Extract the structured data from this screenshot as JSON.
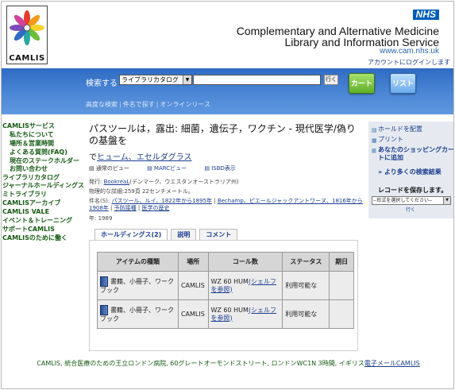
{
  "header": {
    "logo_text": "CAMLIS",
    "nhs_badge": "NHS",
    "site_title_line1": "Complementary and Alternative Medicine",
    "site_title_line2": "Library and Information Service",
    "site_url": "www.cam.nhs.uk",
    "login_link": "アカウントにログインします"
  },
  "search": {
    "label": "検索する",
    "catalog_select": "ライブラリカタログ",
    "query": "",
    "go_label": "行く",
    "cart_label": "カート",
    "list_label": "リスト",
    "links": [
      "高度な検索",
      "件名で探す",
      "オンラインリース"
    ]
  },
  "left_nav": {
    "items": [
      {
        "label": "CAMLISサービス",
        "indent": false
      },
      {
        "label": "私たちについて",
        "indent": true
      },
      {
        "label": "場所＆営業時間",
        "indent": true
      },
      {
        "label": "よくある質問(FAQ)",
        "indent": true
      },
      {
        "label": "現在のステークホルダー",
        "indent": true
      },
      {
        "label": "お問い合わせ",
        "indent": true
      },
      {
        "label": "ライブラリカタログ",
        "indent": false
      },
      {
        "label": "ジャーナルホールディングス",
        "indent": false
      },
      {
        "label": "ミトライブラリ",
        "indent": false
      },
      {
        "label": "CAMLISアーカイブ",
        "indent": false
      },
      {
        "label": "CAMLIS VALE",
        "indent": false
      },
      {
        "label": "イベント＆トレーニング",
        "indent": false
      },
      {
        "label": "サポートCAMLIS",
        "indent": false
      },
      {
        "label": "CAMLISのために働く",
        "indent": false
      }
    ]
  },
  "record": {
    "title": "パスツールは，露出: 細菌，遺伝子，ワクチン - 現代医学/偽りの基盤を",
    "author_prefix": "で",
    "author": "ヒューム、エセルダグラス",
    "views": [
      "通常のビュー",
      "MARCビュー",
      "ISBD表示"
    ],
    "publisher_label": "発行:",
    "publisher": "BookreaL",
    "publisher_note": "(デンマーク、ウエスタンオーストラリア州)",
    "physical_label": "物理的な詳細:",
    "physical": "259頁 22センチメートル。",
    "subjects_label": "件名(S):",
    "subjects": [
      "パスツール、ルイ、1822年から1895年",
      "Bechamp、ピエールジャックアントワーヌ、1816年から1908年",
      "予防接種",
      "医学の歴史"
    ],
    "year_label": "年:",
    "year": "1989"
  },
  "tabs": [
    "ホールディングス(2)",
    "説明",
    "コメント"
  ],
  "holdings": {
    "headers": [
      "アイテムの種類",
      "場所",
      "コール数",
      "ステータス",
      "期日"
    ],
    "rows": [
      {
        "type": "書籍、小冊子、ワークブック",
        "location": "CAMLIS",
        "call_number": "WZ 60 HUM",
        "shelf_link": "(シェルフを参照)",
        "status": "利用可能な",
        "due": ""
      },
      {
        "type": "書籍、小冊子、ワークブック",
        "location": "CAMLIS",
        "call_number": "WZ 60 HUM",
        "shelf_link": "(シェルフを参照)",
        "status": "利用可能な",
        "due": ""
      }
    ]
  },
  "sidebar": {
    "place_hold": "ホールドを配置",
    "print": "プリント",
    "add_cart": "あなたのショッピングカートに追加",
    "more_results": "より多くの検索結果",
    "save_label": "レコードを保存します。",
    "format_select": "--形式を選択してください--",
    "go_label": "行く"
  },
  "footer": {
    "text": "CAMLIS, 統合医療のための王立ロンドン病院, 60グレートオーモンドストリート, ロンドンWC1N 3時間, イギリス",
    "email_link": "電子メールCAMLIS"
  }
}
